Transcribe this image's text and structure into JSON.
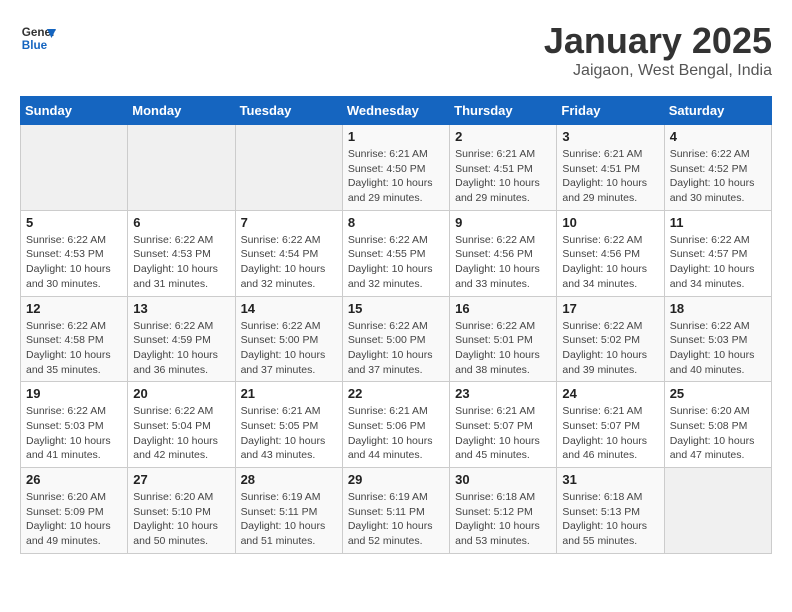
{
  "header": {
    "logo_line1": "General",
    "logo_line2": "Blue",
    "title": "January 2025",
    "subtitle": "Jaigaon, West Bengal, India"
  },
  "days_of_week": [
    "Sunday",
    "Monday",
    "Tuesday",
    "Wednesday",
    "Thursday",
    "Friday",
    "Saturday"
  ],
  "weeks": [
    [
      {
        "day": "",
        "info": ""
      },
      {
        "day": "",
        "info": ""
      },
      {
        "day": "",
        "info": ""
      },
      {
        "day": "1",
        "info": "Sunrise: 6:21 AM\nSunset: 4:50 PM\nDaylight: 10 hours\nand 29 minutes."
      },
      {
        "day": "2",
        "info": "Sunrise: 6:21 AM\nSunset: 4:51 PM\nDaylight: 10 hours\nand 29 minutes."
      },
      {
        "day": "3",
        "info": "Sunrise: 6:21 AM\nSunset: 4:51 PM\nDaylight: 10 hours\nand 29 minutes."
      },
      {
        "day": "4",
        "info": "Sunrise: 6:22 AM\nSunset: 4:52 PM\nDaylight: 10 hours\nand 30 minutes."
      }
    ],
    [
      {
        "day": "5",
        "info": "Sunrise: 6:22 AM\nSunset: 4:53 PM\nDaylight: 10 hours\nand 30 minutes."
      },
      {
        "day": "6",
        "info": "Sunrise: 6:22 AM\nSunset: 4:53 PM\nDaylight: 10 hours\nand 31 minutes."
      },
      {
        "day": "7",
        "info": "Sunrise: 6:22 AM\nSunset: 4:54 PM\nDaylight: 10 hours\nand 32 minutes."
      },
      {
        "day": "8",
        "info": "Sunrise: 6:22 AM\nSunset: 4:55 PM\nDaylight: 10 hours\nand 32 minutes."
      },
      {
        "day": "9",
        "info": "Sunrise: 6:22 AM\nSunset: 4:56 PM\nDaylight: 10 hours\nand 33 minutes."
      },
      {
        "day": "10",
        "info": "Sunrise: 6:22 AM\nSunset: 4:56 PM\nDaylight: 10 hours\nand 34 minutes."
      },
      {
        "day": "11",
        "info": "Sunrise: 6:22 AM\nSunset: 4:57 PM\nDaylight: 10 hours\nand 34 minutes."
      }
    ],
    [
      {
        "day": "12",
        "info": "Sunrise: 6:22 AM\nSunset: 4:58 PM\nDaylight: 10 hours\nand 35 minutes."
      },
      {
        "day": "13",
        "info": "Sunrise: 6:22 AM\nSunset: 4:59 PM\nDaylight: 10 hours\nand 36 minutes."
      },
      {
        "day": "14",
        "info": "Sunrise: 6:22 AM\nSunset: 5:00 PM\nDaylight: 10 hours\nand 37 minutes."
      },
      {
        "day": "15",
        "info": "Sunrise: 6:22 AM\nSunset: 5:00 PM\nDaylight: 10 hours\nand 37 minutes."
      },
      {
        "day": "16",
        "info": "Sunrise: 6:22 AM\nSunset: 5:01 PM\nDaylight: 10 hours\nand 38 minutes."
      },
      {
        "day": "17",
        "info": "Sunrise: 6:22 AM\nSunset: 5:02 PM\nDaylight: 10 hours\nand 39 minutes."
      },
      {
        "day": "18",
        "info": "Sunrise: 6:22 AM\nSunset: 5:03 PM\nDaylight: 10 hours\nand 40 minutes."
      }
    ],
    [
      {
        "day": "19",
        "info": "Sunrise: 6:22 AM\nSunset: 5:03 PM\nDaylight: 10 hours\nand 41 minutes."
      },
      {
        "day": "20",
        "info": "Sunrise: 6:22 AM\nSunset: 5:04 PM\nDaylight: 10 hours\nand 42 minutes."
      },
      {
        "day": "21",
        "info": "Sunrise: 6:21 AM\nSunset: 5:05 PM\nDaylight: 10 hours\nand 43 minutes."
      },
      {
        "day": "22",
        "info": "Sunrise: 6:21 AM\nSunset: 5:06 PM\nDaylight: 10 hours\nand 44 minutes."
      },
      {
        "day": "23",
        "info": "Sunrise: 6:21 AM\nSunset: 5:07 PM\nDaylight: 10 hours\nand 45 minutes."
      },
      {
        "day": "24",
        "info": "Sunrise: 6:21 AM\nSunset: 5:07 PM\nDaylight: 10 hours\nand 46 minutes."
      },
      {
        "day": "25",
        "info": "Sunrise: 6:20 AM\nSunset: 5:08 PM\nDaylight: 10 hours\nand 47 minutes."
      }
    ],
    [
      {
        "day": "26",
        "info": "Sunrise: 6:20 AM\nSunset: 5:09 PM\nDaylight: 10 hours\nand 49 minutes."
      },
      {
        "day": "27",
        "info": "Sunrise: 6:20 AM\nSunset: 5:10 PM\nDaylight: 10 hours\nand 50 minutes."
      },
      {
        "day": "28",
        "info": "Sunrise: 6:19 AM\nSunset: 5:11 PM\nDaylight: 10 hours\nand 51 minutes."
      },
      {
        "day": "29",
        "info": "Sunrise: 6:19 AM\nSunset: 5:11 PM\nDaylight: 10 hours\nand 52 minutes."
      },
      {
        "day": "30",
        "info": "Sunrise: 6:18 AM\nSunset: 5:12 PM\nDaylight: 10 hours\nand 53 minutes."
      },
      {
        "day": "31",
        "info": "Sunrise: 6:18 AM\nSunset: 5:13 PM\nDaylight: 10 hours\nand 55 minutes."
      },
      {
        "day": "",
        "info": ""
      }
    ]
  ]
}
